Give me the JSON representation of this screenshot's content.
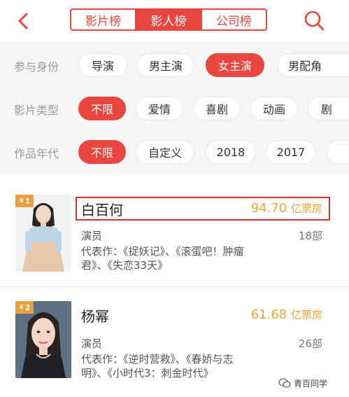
{
  "header": {
    "tabs": [
      {
        "label": "影片榜",
        "active": false
      },
      {
        "label": "影人榜",
        "active": true
      },
      {
        "label": "公司榜",
        "active": false
      }
    ]
  },
  "filters": {
    "rows": [
      {
        "label": "参与身份",
        "options": [
          "导演",
          "男主演",
          "女主演",
          "男配角"
        ],
        "selected": "女主演"
      },
      {
        "label": "影片类型",
        "options": [
          "不限",
          "爱情",
          "喜剧",
          "动画",
          "剧"
        ],
        "selected": "不限"
      },
      {
        "label": "作品年代",
        "options": [
          "不限",
          "自定义",
          "2018",
          "2017"
        ],
        "selected": "不限"
      }
    ]
  },
  "list": [
    {
      "rank": "1",
      "name": "白百何",
      "boxoffice_value": "94.70",
      "boxoffice_unit": "亿票房",
      "role": "演员",
      "count": "18部",
      "works_line1": "代表作：《捉妖记》、《滚蛋吧！肿瘤",
      "works_line2": "君》、《失恋33天》"
    },
    {
      "rank": "2",
      "name": "杨幂",
      "boxoffice_value": "61.68",
      "boxoffice_unit": "亿票房",
      "role": "演员",
      "count": "26部",
      "works_line1": "代表作：《逆时营救》、《春娇与志",
      "works_line2": "明》、《小时代3：刺金时代》"
    }
  ],
  "watermark": {
    "text": "青百同学"
  },
  "colors": {
    "accent": "#e8463f",
    "boxoffice": "#f0a53b",
    "badge": "#e8a03c"
  }
}
